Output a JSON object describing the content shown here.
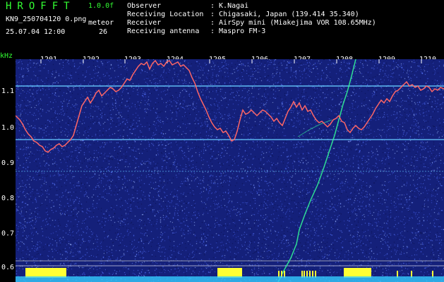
{
  "header": {
    "app_title": "HROFFT",
    "version": "1.0.0f",
    "filename": "KN9_250704120 0.png",
    "datetime": "25.07.04 12:00",
    "meteor_label": "meteor",
    "meteor_count": "26"
  },
  "info": [
    {
      "label": "Observer",
      "value": ": K.Nagai"
    },
    {
      "label": "Receiving Location",
      "value": ": Chigasaki, Japan (139.414 35.340)"
    },
    {
      "label": "Receiver",
      "value": ": AirSpy mini (Miakejima VOR 108.65MHz)"
    },
    {
      "label": "Receiving antenna",
      "value": ": Maspro FM-3"
    }
  ],
  "axis": {
    "freq_unit": "kHz",
    "time_labels": [
      "1201",
      "1202",
      "1203",
      "1204",
      "1205",
      "1206",
      "1207",
      "1208",
      "1209",
      "1210"
    ],
    "freq_labels": [
      "1.1",
      "1.0",
      "0.9",
      "0.8",
      "0.7",
      "0.6"
    ]
  },
  "colors": {
    "background": "#1a2a8c",
    "trace": "#ff6666",
    "reference_line": "#66ccff",
    "echo_bar": "#ffff33",
    "baseline": "#33ccff",
    "title_green": "#33ff33"
  }
}
